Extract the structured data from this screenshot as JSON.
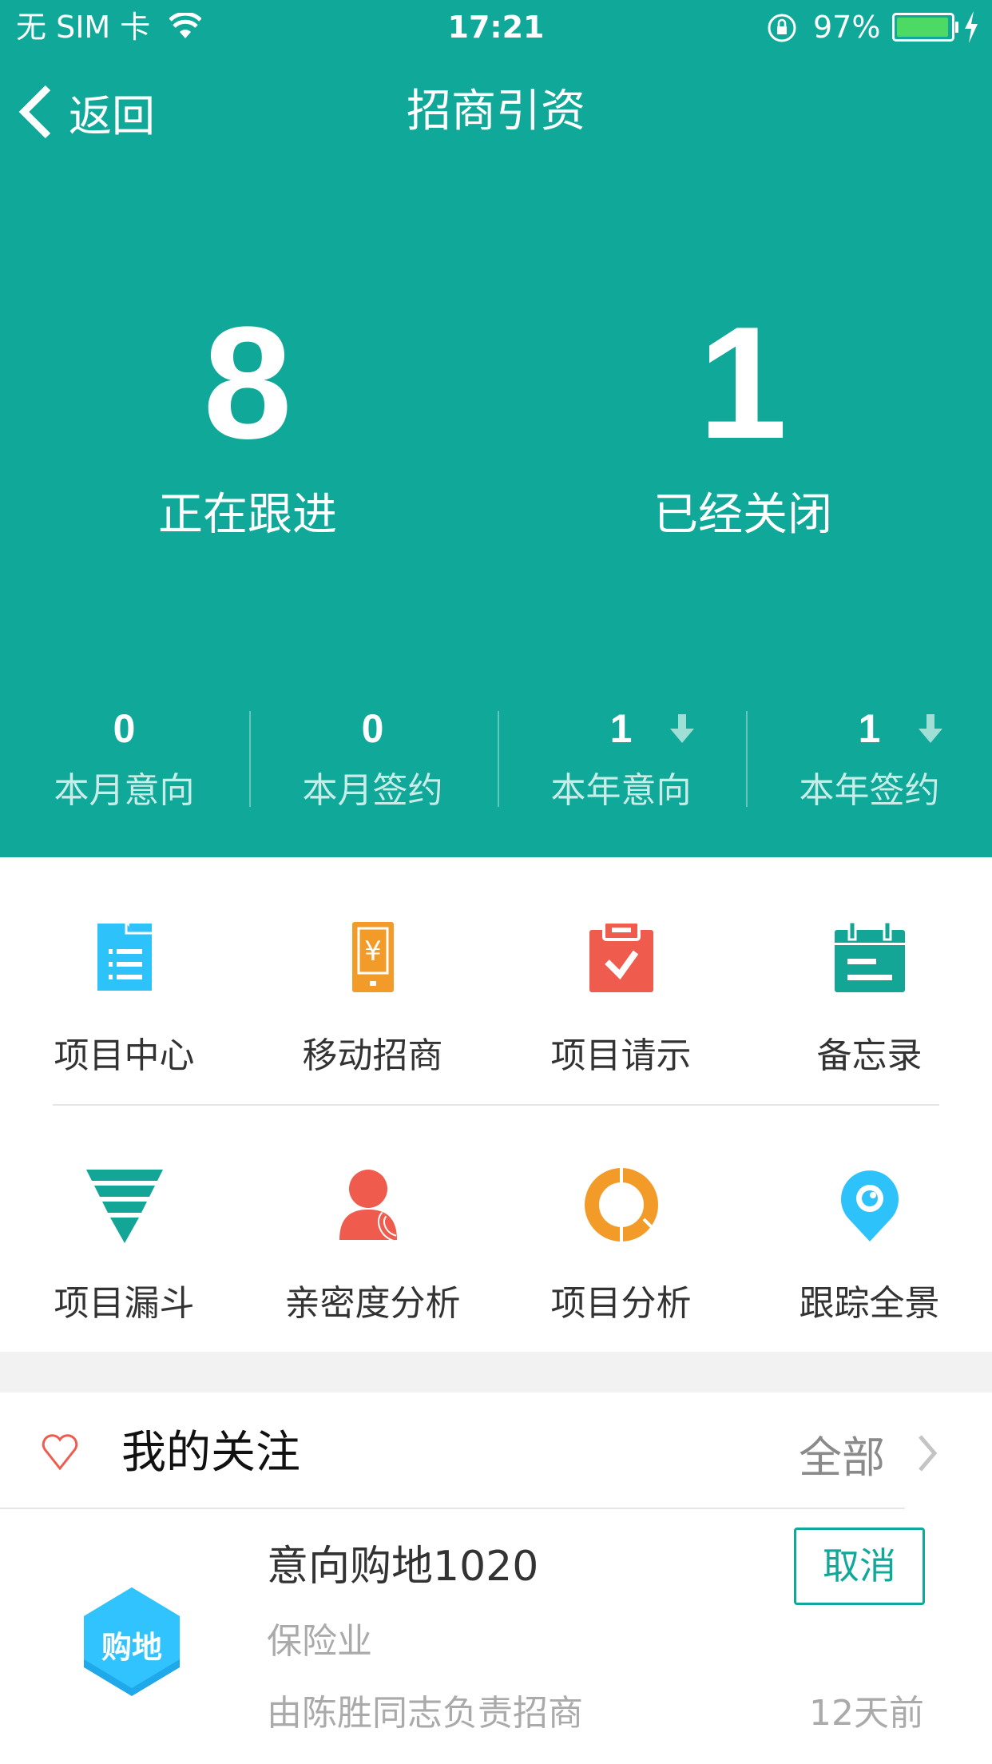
{
  "status_bar": {
    "carrier": "无 SIM 卡",
    "time": "17:21",
    "battery": "97%",
    "battery_level": 0.97
  },
  "nav": {
    "back_label": "返回",
    "title": "招商引资"
  },
  "summary": [
    {
      "value": "8",
      "label": "正在跟进"
    },
    {
      "value": "1",
      "label": "已经关闭"
    }
  ],
  "stats": [
    {
      "value": "0",
      "label": "本月意向",
      "trend": null
    },
    {
      "value": "0",
      "label": "本月签约",
      "trend": null
    },
    {
      "value": "1",
      "label": "本年意向",
      "trend": "down"
    },
    {
      "value": "1",
      "label": "本年签约",
      "trend": "down"
    }
  ],
  "menu": [
    {
      "label": "项目中心",
      "icon": "folder-list-icon",
      "color": "#2ec2fb"
    },
    {
      "label": "移动招商",
      "icon": "mobile-yen-icon",
      "color": "#f39b28"
    },
    {
      "label": "项目请示",
      "icon": "clipboard-check-icon",
      "color": "#ef5b4c"
    },
    {
      "label": "备忘录",
      "icon": "calendar-icon",
      "color": "#13a595"
    },
    {
      "label": "项目漏斗",
      "icon": "funnel-icon",
      "color": "#13a595"
    },
    {
      "label": "亲密度分析",
      "icon": "contact-phone-icon",
      "color": "#ef5b4c"
    },
    {
      "label": "项目分析",
      "icon": "donut-chart-icon",
      "color": "#f39b28"
    },
    {
      "label": "跟踪全景",
      "icon": "location-eye-icon",
      "color": "#2ec2fb"
    }
  ],
  "favorites": {
    "title": "我的关注",
    "all_label": "全部",
    "items": [
      {
        "badge": "购地",
        "title": "意向购地1020",
        "industry": "保险业",
        "owner": "由陈胜同志负责招商",
        "time": "12天前",
        "action": "取消"
      }
    ]
  },
  "colors": {
    "primary": "#10a898",
    "accent_red": "#ef5b4c"
  }
}
